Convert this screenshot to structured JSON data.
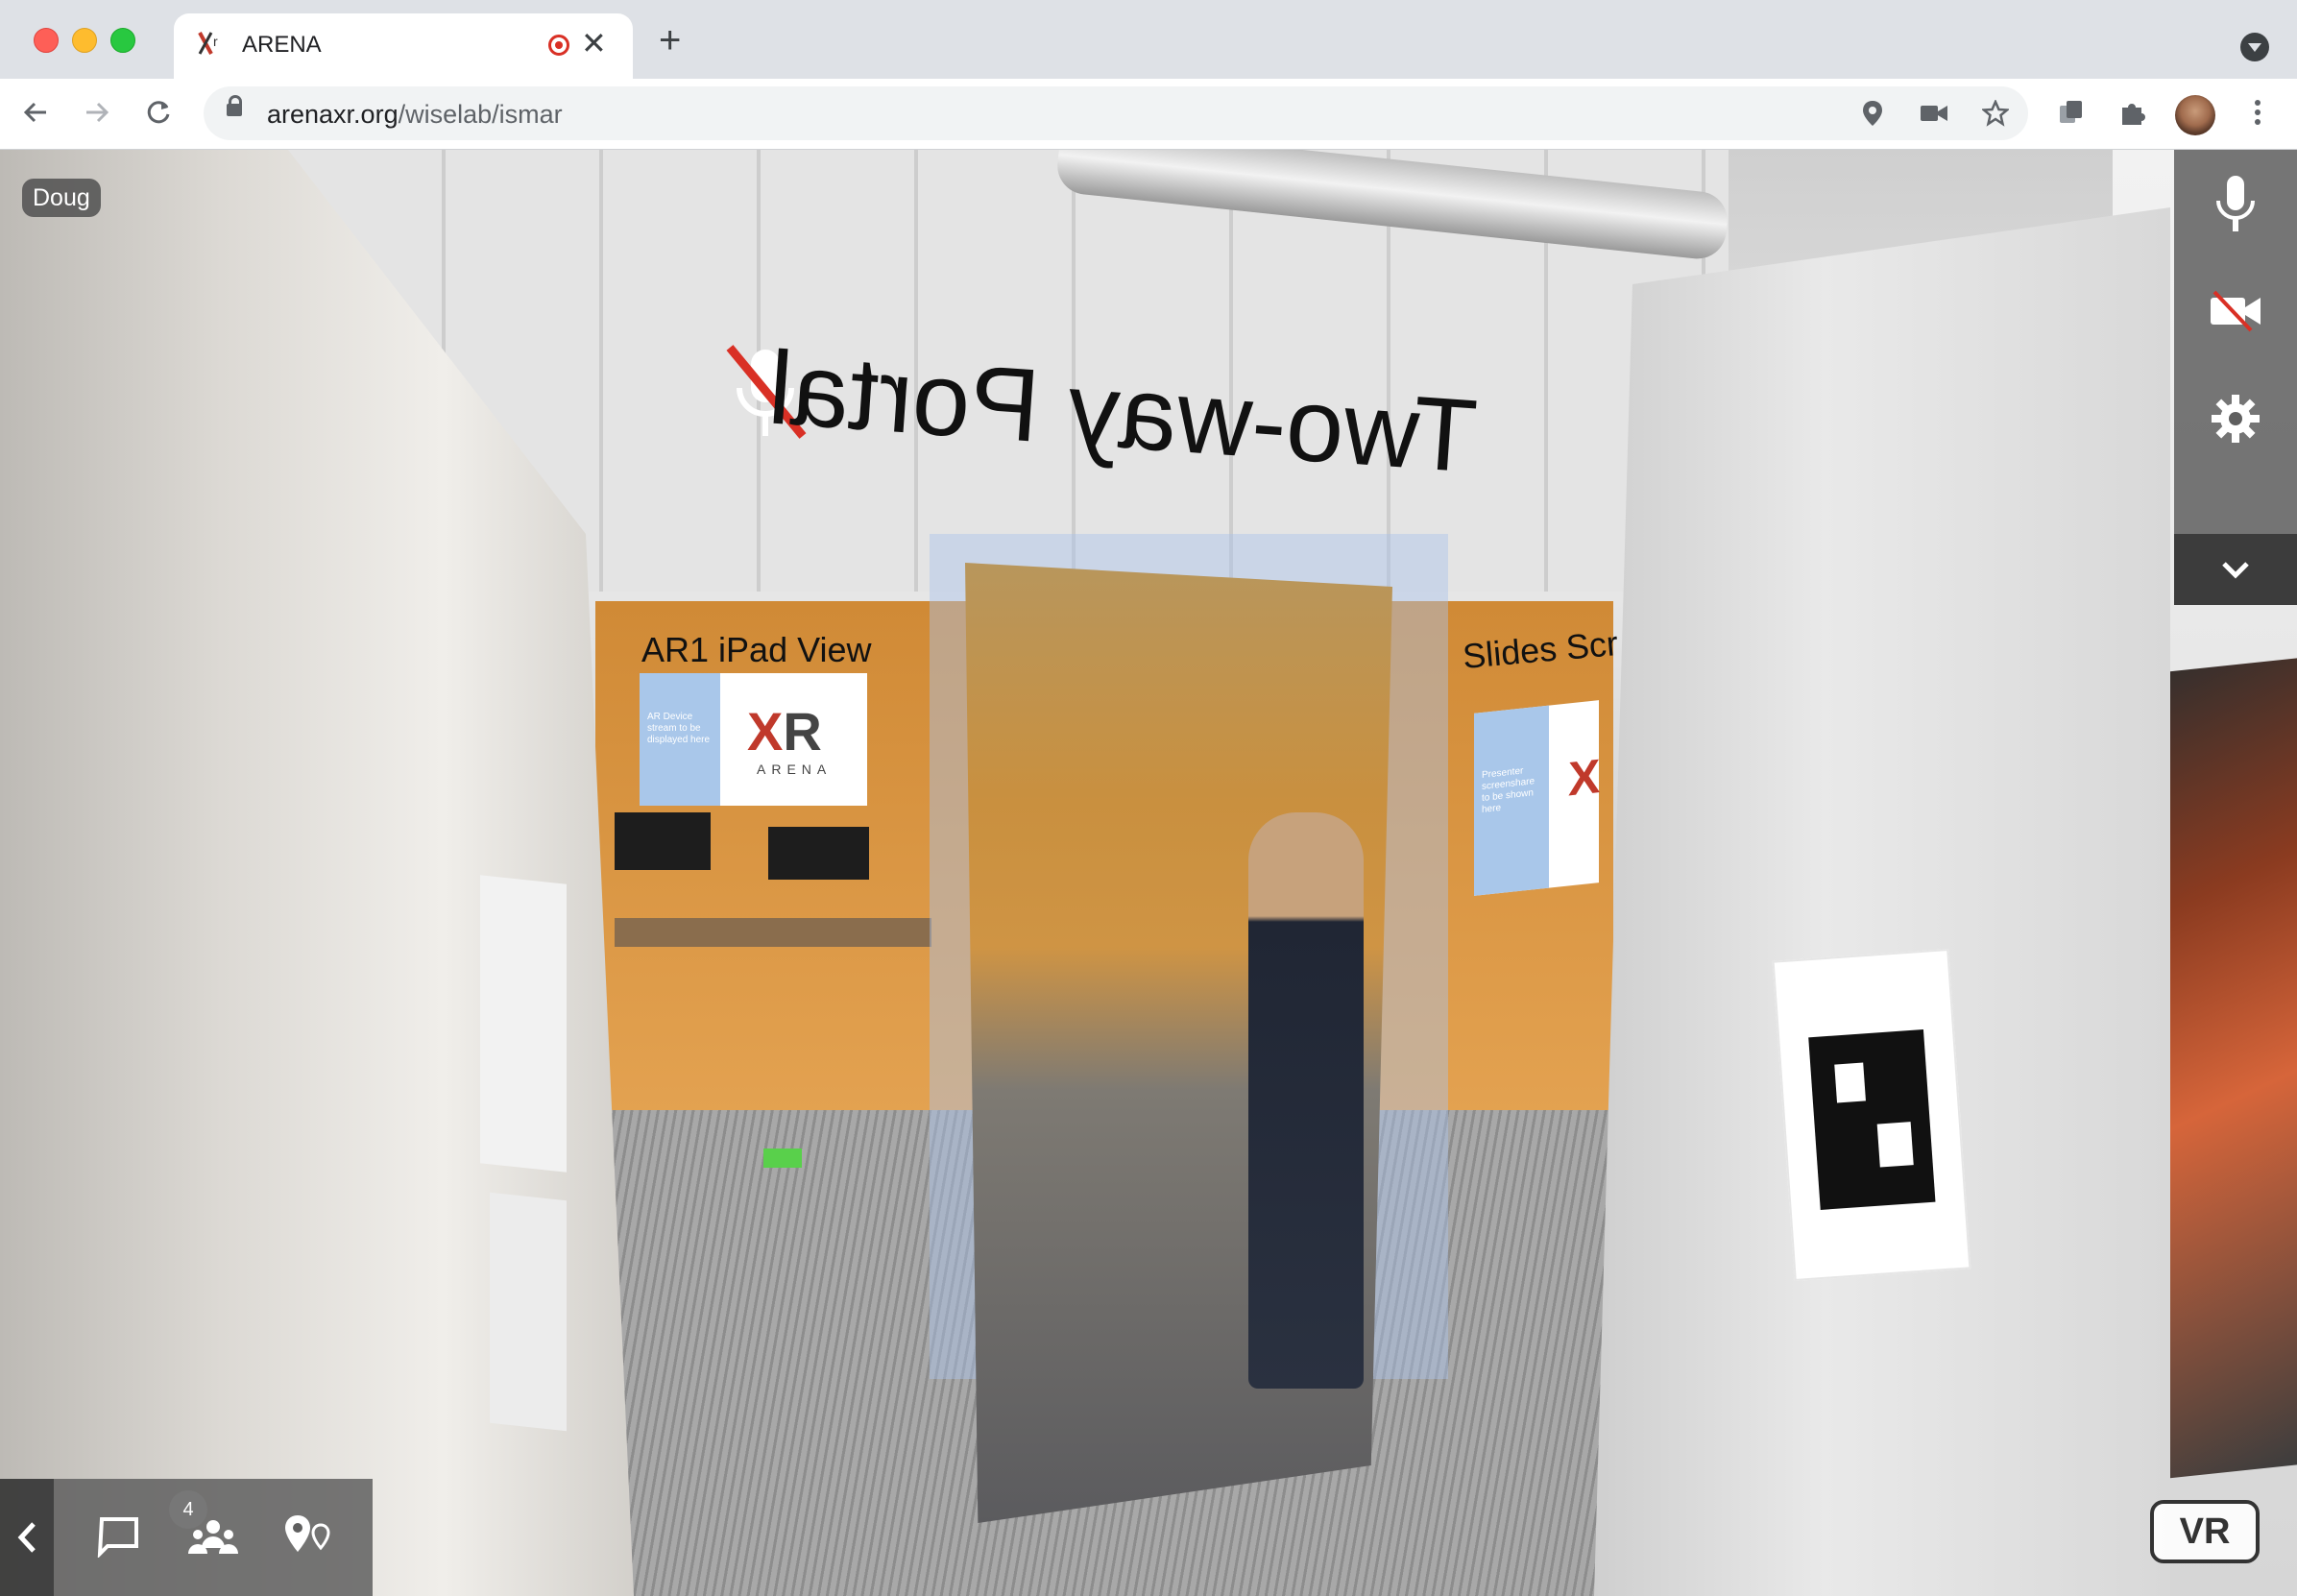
{
  "browser": {
    "tab": {
      "title": "ARENA"
    },
    "new_tab_glyph": "+",
    "close_glyph": "✕",
    "address": {
      "domain": "arenaxr.org",
      "path": "/wiselab/ismar"
    },
    "icons": [
      "back-icon",
      "forward-icon",
      "reload-icon",
      "lock-icon",
      "location-icon",
      "camera-icon",
      "star-icon",
      "extension-icon",
      "puzzle-icon",
      "profile-avatar",
      "more-icon"
    ]
  },
  "scene": {
    "user_name": "Doug",
    "portal_label": "Two-way Portal",
    "ipad_panel": {
      "title": "AR1 iPad View",
      "side_text": "AR Device stream to be displayed here",
      "logo_x": "X",
      "logo_r": "R",
      "logo_sub": "ARENA"
    },
    "slides_panel": {
      "title": "Slides Scr",
      "side_text": "Presenter screenshare to be shown here",
      "logo_x": "X"
    }
  },
  "arena_ui": {
    "side_panel": [
      "mic-icon",
      "camera-off-icon",
      "settings-icon",
      "chevron-down-icon"
    ],
    "bottom_bar": {
      "user_count": "4",
      "buttons": [
        "collapse-icon",
        "chat-icon",
        "users-icon",
        "landmarks-icon"
      ]
    },
    "vr_label": "VR"
  },
  "colors": {
    "accent_red": "#d93025",
    "panel_gray": "#5f5f5f"
  }
}
